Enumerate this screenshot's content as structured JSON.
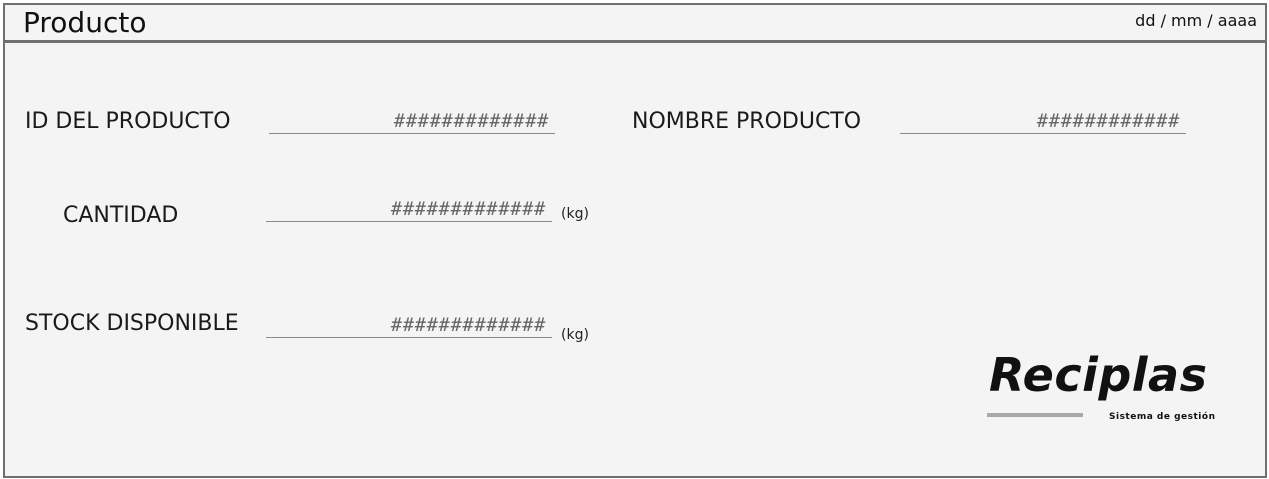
{
  "header": {
    "title": "Producto",
    "date_placeholder": "dd / mm / aaaa"
  },
  "form": {
    "id_producto": {
      "label": "ID DEL PRODUCTO",
      "value": "#############"
    },
    "nombre_producto": {
      "label": "NOMBRE PRODUCTO",
      "value": "############"
    },
    "cantidad": {
      "label": "CANTIDAD",
      "value": "#############",
      "unit": "(kg)"
    },
    "stock_disponible": {
      "label": "STOCK DISPONIBLE",
      "value": "#############",
      "unit": "(kg)"
    }
  },
  "logo": {
    "name": "Reciplas",
    "tagline": "Sistema de gestión"
  },
  "colors": {
    "background": "#f4f4f4",
    "border": "#6f6f6f",
    "text": "#1a1a1a",
    "placeholder": "#666666",
    "accent_bar": "#a9a9a9"
  }
}
